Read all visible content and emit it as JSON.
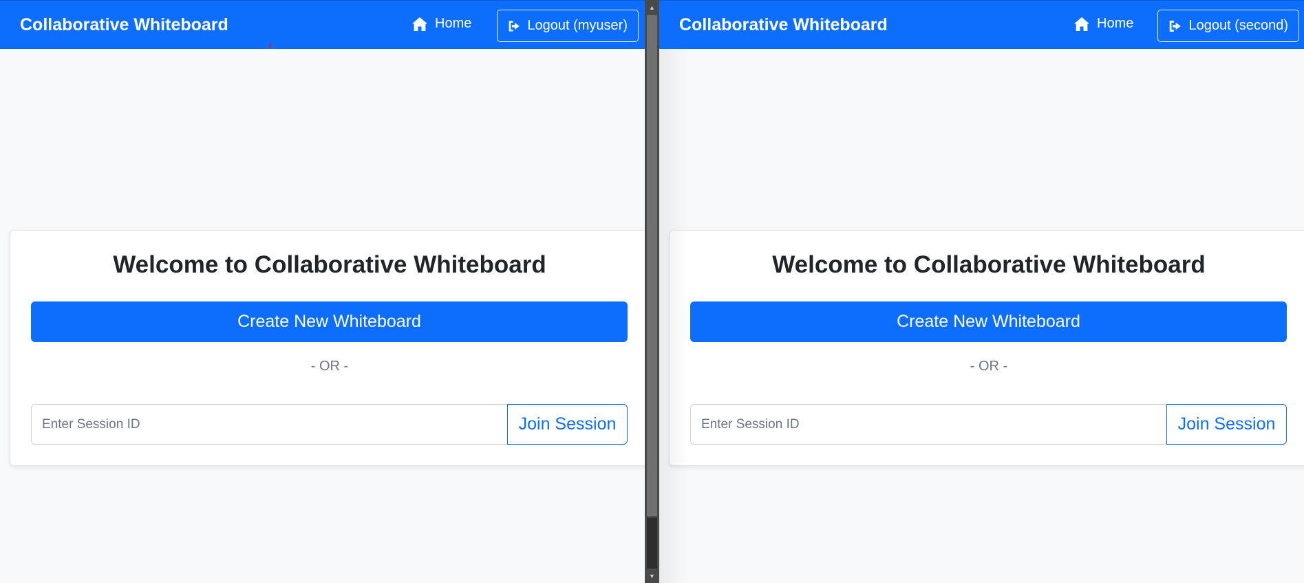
{
  "windows": [
    {
      "navbar": {
        "brand": "Collaborative Whiteboard",
        "home_label": "Home",
        "logout_label": "Logout (myuser)"
      },
      "card": {
        "title": "Welcome to Collaborative Whiteboard",
        "create_button": "Create New Whiteboard",
        "or_divider": "- OR -",
        "session_input_placeholder": "Enter Session ID",
        "session_input_value": "",
        "join_button": "Join Session"
      }
    },
    {
      "navbar": {
        "brand": "Collaborative Whiteboard",
        "home_label": "Home",
        "logout_label": "Logout (second)"
      },
      "card": {
        "title": "Welcome to Collaborative Whiteboard",
        "create_button": "Create New Whiteboard",
        "or_divider": "- OR -",
        "session_input_placeholder": "Enter Session ID",
        "session_input_value": "",
        "join_button": "Join Session"
      }
    }
  ],
  "icons": {
    "home": "house-icon",
    "logout": "sign-out-icon",
    "scroll_up": "triangle-up-icon",
    "scroll_down": "triangle-down-icon"
  },
  "colors": {
    "primary": "#0d6efd",
    "page_background": "#f8f9fa",
    "card_background": "#ffffff",
    "heading_text": "#212529",
    "muted_text": "#6c757d",
    "scrollbar_track": "#4a4a4a",
    "scrollbar_thumb": "#707070"
  }
}
